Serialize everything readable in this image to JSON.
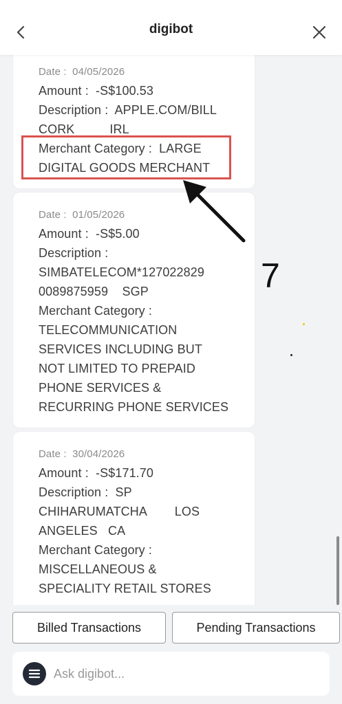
{
  "header": {
    "title": "digibot"
  },
  "transactions": [
    {
      "date": "Date :  04/05/2026",
      "amount": "Amount :  -S$100.53",
      "description_lines": [
        "Description :  APPLE.COM/BILL",
        "CORK          IRL"
      ],
      "merchant_lines": [
        "Merchant Category :  LARGE",
        "DIGITAL GOODS MERCHANT"
      ]
    },
    {
      "date": "Date :  01/05/2026",
      "amount": "Amount :  -S$5.00",
      "description_lines": [
        "Description :",
        "SIMBATELECOM*127022829",
        "0089875959    SGP"
      ],
      "merchant_lines": [
        "Merchant Category :",
        "TELECOMMUNICATION",
        "SERVICES INCLUDING BUT",
        "NOT LIMITED TO PREPAID",
        "PHONE SERVICES &",
        "RECURRING PHONE SERVICES"
      ]
    },
    {
      "date": "Date :  30/04/2026",
      "amount": "Amount :  -S$171.70",
      "description_lines": [
        "Description :  SP",
        "CHIHARUMATCHA        LOS",
        "ANGELES   CA"
      ],
      "merchant_lines": [
        "Merchant Category :",
        "MISCELLANEOUS &",
        "SPECIALITY RETAIL STORES"
      ]
    }
  ],
  "annotation": {
    "number": "7"
  },
  "tabs": {
    "billed": "Billed Transactions",
    "pending": "Pending Transactions"
  },
  "ask": {
    "placeholder": "Ask digibot..."
  },
  "colors": {
    "highlight": "#d9534f",
    "menu_button": "#232a36"
  }
}
